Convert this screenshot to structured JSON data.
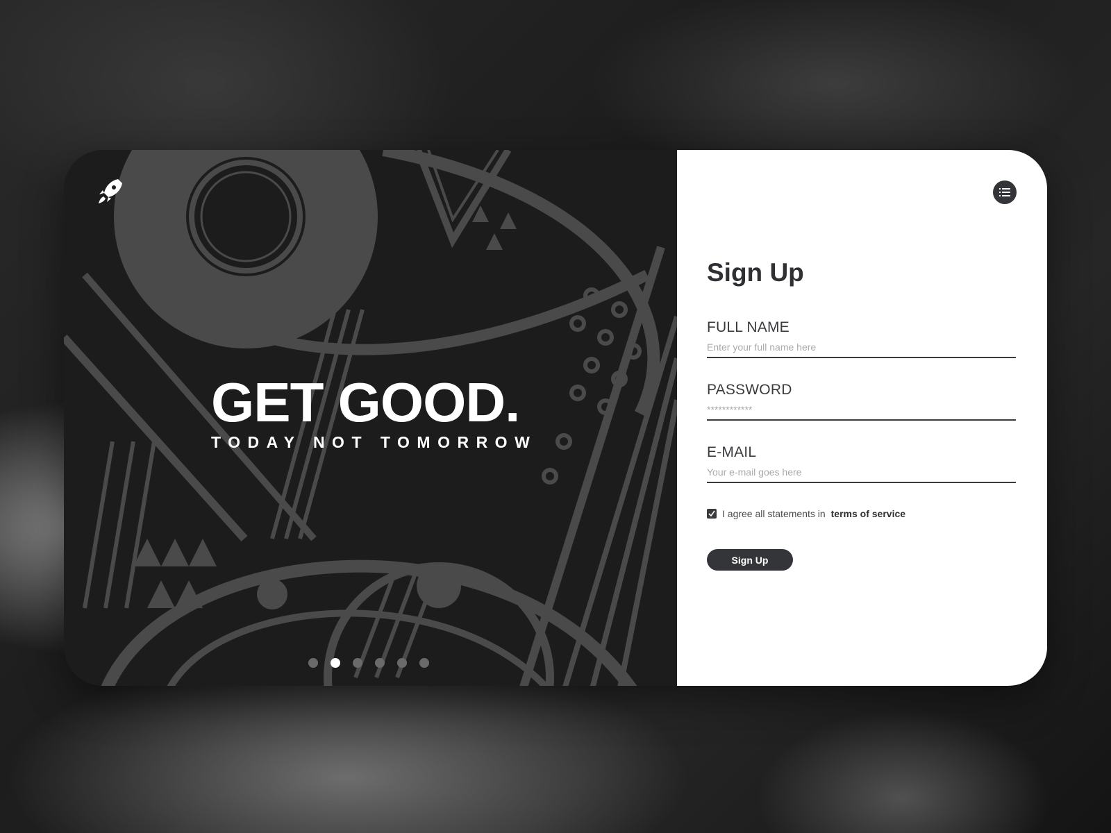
{
  "hero": {
    "title": "GET GOOD.",
    "subtitle": "TODAY NOT TOMORROW"
  },
  "carousel": {
    "slide_count": 6,
    "active_index": 1
  },
  "form": {
    "title": "Sign Up",
    "full_name": {
      "label": "FULL NAME",
      "placeholder": "Enter your full name here"
    },
    "password": {
      "label": "PASSWORD",
      "placeholder": "************"
    },
    "email": {
      "label": "E-MAIL",
      "placeholder": "Your e-mail goes here"
    },
    "agree_text": "I agree all statements in",
    "agree_link": "terms of service",
    "agree_checked": true,
    "submit_label": "Sign Up"
  },
  "icons": {
    "logo": "rocket-icon",
    "menu": "list-icon",
    "checkbox": "checkmark-icon"
  },
  "colors": {
    "art_dark": "#1c1c1c",
    "art_light": "#4a4a4a",
    "accent_dark": "#333538",
    "form_bg": "#ffffff"
  }
}
